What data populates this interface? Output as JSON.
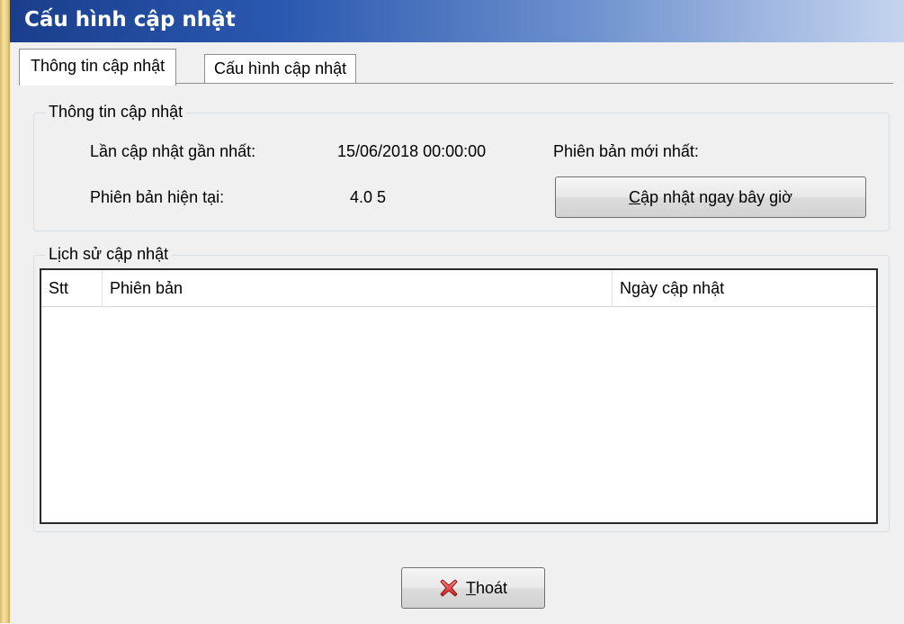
{
  "window": {
    "title": "Cấu hình cập nhật"
  },
  "tabs": [
    {
      "label": "Thông tin cập nhật",
      "active": true
    },
    {
      "label": "Cấu hình cập nhật",
      "active": false
    }
  ],
  "update_info": {
    "group_title": "Thông tin cập nhật",
    "last_update_label": "Lần cập nhật gần nhất:",
    "last_update_value": "15/06/2018 00:00:00",
    "latest_version_label": "Phiên bản mới nhất:",
    "current_version_label": "Phiên bản hiện tại:",
    "current_version_value": "4.0 5",
    "update_now_button": "Cập nhật ngay bây giờ"
  },
  "history": {
    "group_title": "Lịch sử cập nhật",
    "columns": [
      "Stt",
      "Phiên bản",
      "Ngày cập nhật"
    ],
    "rows": []
  },
  "footer": {
    "exit_button": "Thoát"
  },
  "colors": {
    "titlebar_start": "#1a3e8c",
    "titlebar_end": "#c5d4ee",
    "close_icon": "#e23b3b"
  },
  "icons": {
    "exit_button_icon": "close-icon"
  }
}
